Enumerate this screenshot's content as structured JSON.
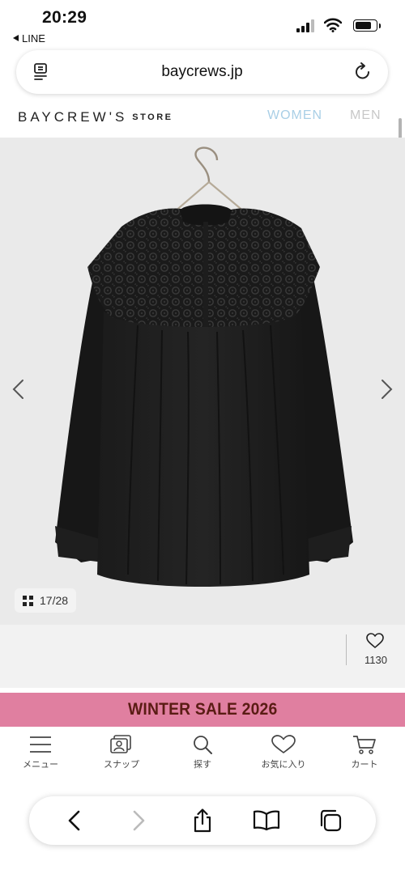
{
  "status_bar": {
    "time": "20:29",
    "back_app": "LINE"
  },
  "address_bar": {
    "url": "baycrews.jp"
  },
  "site_header": {
    "logo": "BAYCREW'S",
    "logo_suffix": "STORE",
    "nav_women": "WOMEN",
    "nav_men": "MEN"
  },
  "gallery": {
    "counter": "17/28"
  },
  "favorite": {
    "count": "1130"
  },
  "banner": {
    "text": "WINTER SALE 2026"
  },
  "tabs": [
    {
      "label": "メニュー",
      "icon": "menu-icon"
    },
    {
      "label": "スナップ",
      "icon": "snap-icon"
    },
    {
      "label": "探す",
      "icon": "search-icon"
    },
    {
      "label": "お気に入り",
      "icon": "heart-icon"
    },
    {
      "label": "カート",
      "icon": "cart-icon"
    }
  ],
  "toolbar": {
    "icons": [
      "back-icon",
      "forward-icon",
      "share-icon",
      "bookmarks-icon",
      "tabs-icon"
    ]
  },
  "colors": {
    "banner_bg": "#e07fa0",
    "banner_text": "#5a1c14",
    "nav_active": "#a9cfe6",
    "nav_inactive": "#c8c8c8"
  }
}
